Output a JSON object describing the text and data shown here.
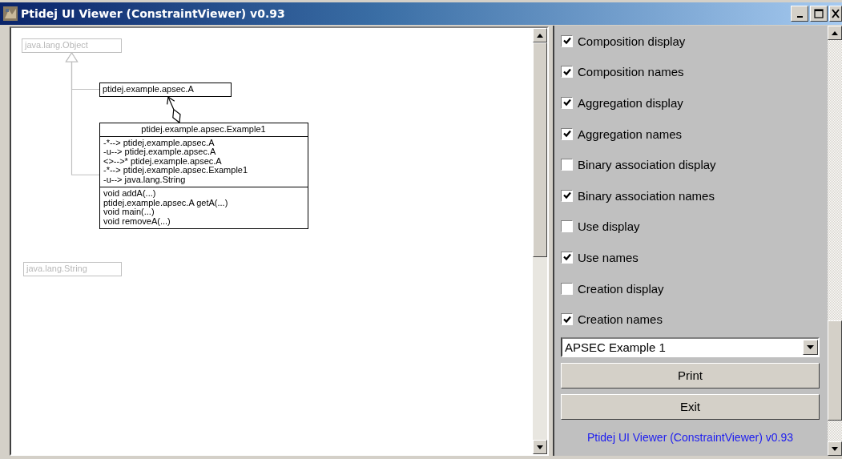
{
  "window": {
    "title": "Ptidej UI Viewer (ConstraintViewer) v0.93"
  },
  "diagram": {
    "classes": [
      {
        "name": "java.lang.Object",
        "ghost": true,
        "generalization": false,
        "composition": false
      },
      {
        "name": "ptidej.example.apsec.A",
        "ghost": false,
        "generalization": true,
        "composition": false
      },
      {
        "name": "ptidej.example.apsec.Example1",
        "ghost": false,
        "generalization": true,
        "composition": true,
        "attributes": [
          "-*--> ptidej.example.apsec.A",
          "-u--> ptidej.example.apsec.A",
          "<>-->* ptidej.example.apsec.A",
          "-*--> ptidej.example.apsec.Example1",
          "-u--> java.lang.String"
        ],
        "methods": [
          "void addA(...)",
          "ptidej.example.apsec.A getA(...)",
          "void main(...)",
          "void removeA(...)"
        ]
      },
      {
        "name": "java.lang.String",
        "ghost": true,
        "generalization": false,
        "composition": false
      }
    ]
  },
  "options": [
    {
      "label": "Composition display",
      "checked": true
    },
    {
      "label": "Composition names",
      "checked": true
    },
    {
      "label": "Aggregation display",
      "checked": true
    },
    {
      "label": "Aggregation names",
      "checked": true
    },
    {
      "label": "Binary association display",
      "checked": false
    },
    {
      "label": "Binary association names",
      "checked": true
    },
    {
      "label": "Use display",
      "checked": false
    },
    {
      "label": "Use names",
      "checked": true
    },
    {
      "label": "Creation display",
      "checked": false
    },
    {
      "label": "Creation names",
      "checked": true
    }
  ],
  "example_select": {
    "value": "APSEC Example 1"
  },
  "buttons": [
    "Print",
    "Exit"
  ],
  "footer": "Ptidej UI Viewer (ConstraintViewer) v0.93"
}
